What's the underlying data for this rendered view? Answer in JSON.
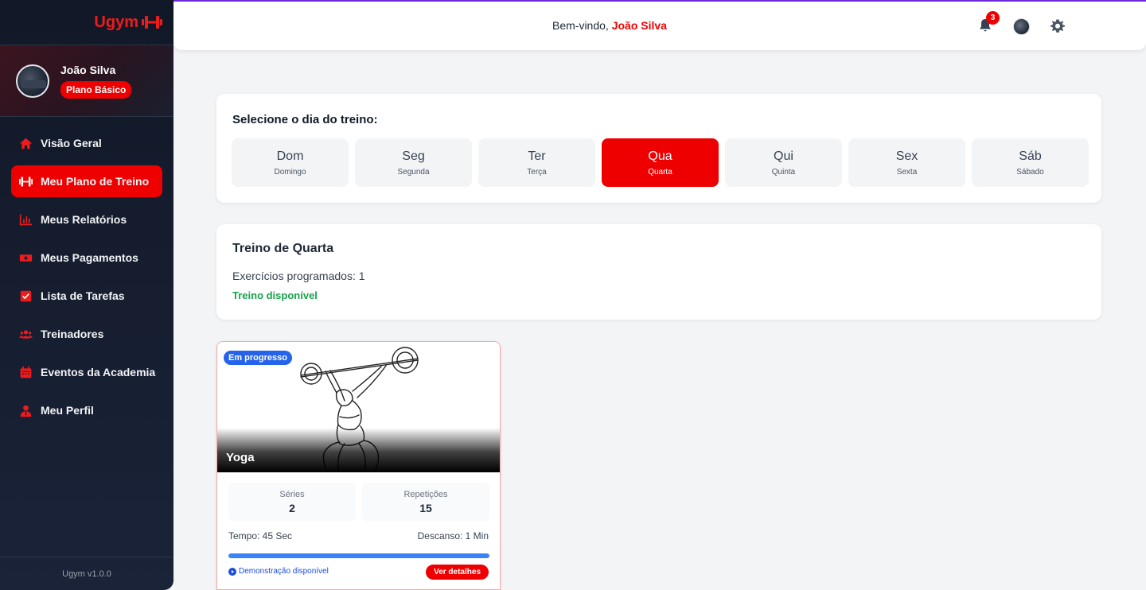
{
  "brand": {
    "name": "Ugym",
    "icon": "dumbbell-icon"
  },
  "user": {
    "name": "João Silva",
    "plan": "Plano Básico"
  },
  "sidebar": {
    "items": [
      {
        "label": "Visão Geral",
        "icon": "home-icon",
        "active": false
      },
      {
        "label": "Meu Plano de Treino",
        "icon": "dumbbell-icon",
        "active": true
      },
      {
        "label": "Meus Relatórios",
        "icon": "bar-chart-icon",
        "active": false
      },
      {
        "label": "Meus Pagamentos",
        "icon": "money-icon",
        "active": false
      },
      {
        "label": "Lista de Tarefas",
        "icon": "checkbox-icon",
        "active": false
      },
      {
        "label": "Treinadores",
        "icon": "users-icon",
        "active": false
      },
      {
        "label": "Eventos da Academia",
        "icon": "calendar-icon",
        "active": false
      },
      {
        "label": "Meu Perfil",
        "icon": "user-tie-icon",
        "active": false
      }
    ],
    "version": "Ugym v1.0.0"
  },
  "header": {
    "welcome_prefix": "Bem-vindo,",
    "welcome_name": "João Silva",
    "notification_count": "3",
    "icons": [
      "bell-icon",
      "avatar",
      "gear-icon"
    ]
  },
  "day_selector": {
    "title": "Selecione o dia do treino:",
    "days": [
      {
        "abbr": "Dom",
        "full": "Domingo",
        "active": false
      },
      {
        "abbr": "Seg",
        "full": "Segunda",
        "active": false
      },
      {
        "abbr": "Ter",
        "full": "Terça",
        "active": false
      },
      {
        "abbr": "Qua",
        "full": "Quarta",
        "active": true
      },
      {
        "abbr": "Qui",
        "full": "Quinta",
        "active": false
      },
      {
        "abbr": "Sex",
        "full": "Sexta",
        "active": false
      },
      {
        "abbr": "Sáb",
        "full": "Sábado",
        "active": false
      }
    ]
  },
  "workout_info": {
    "title": "Treino de Quarta",
    "count_text": "Exercícios programados: 1",
    "status": "Treino disponível"
  },
  "exercise": {
    "name": "Yoga",
    "badge": "Em progresso",
    "sets_label": "Séries",
    "sets_value": "2",
    "reps_label": "Repetições",
    "reps_value": "15",
    "time": "Tempo: 45 Sec",
    "rest": "Descanso: 1 Min",
    "progress": 1.0,
    "demo_text": "Demonstração disponível",
    "details_label": "Ver detalhes"
  },
  "colors": {
    "accent": "#ef0000",
    "sidebar_bg": "#111827",
    "progress_blue": "#3b82f6",
    "success_green": "#16a34a",
    "badge_blue": "#2563eb"
  }
}
